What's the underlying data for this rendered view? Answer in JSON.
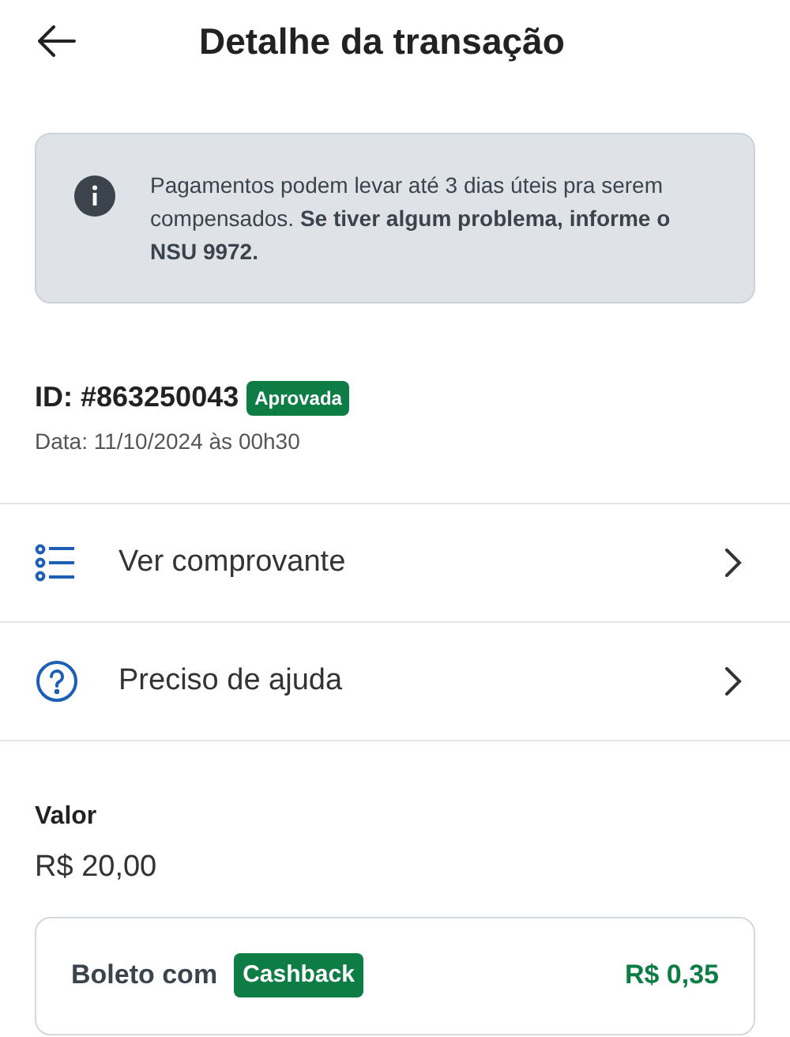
{
  "header": {
    "title": "Detalhe da transação"
  },
  "notice": {
    "text": "Pagamentos podem levar até 3 dias úteis pra serem compensados. **Se tiver algum problema, informe o NSU 9972.**"
  },
  "transaction": {
    "id": "ID: #863250043",
    "status": "Aprovada",
    "date": "Data: 11/10/2024 às 00h30"
  },
  "menu": [
    {
      "kind": "receipt",
      "label": "Ver comprovante"
    },
    {
      "kind": "help",
      "label": "Preciso de ajuda"
    }
  ],
  "amount": {
    "label": "Valor",
    "value": "R$ 20,00"
  },
  "cashback": {
    "label": "Boleto com",
    "badge": "Cashback",
    "value": "R$ 0,35"
  }
}
